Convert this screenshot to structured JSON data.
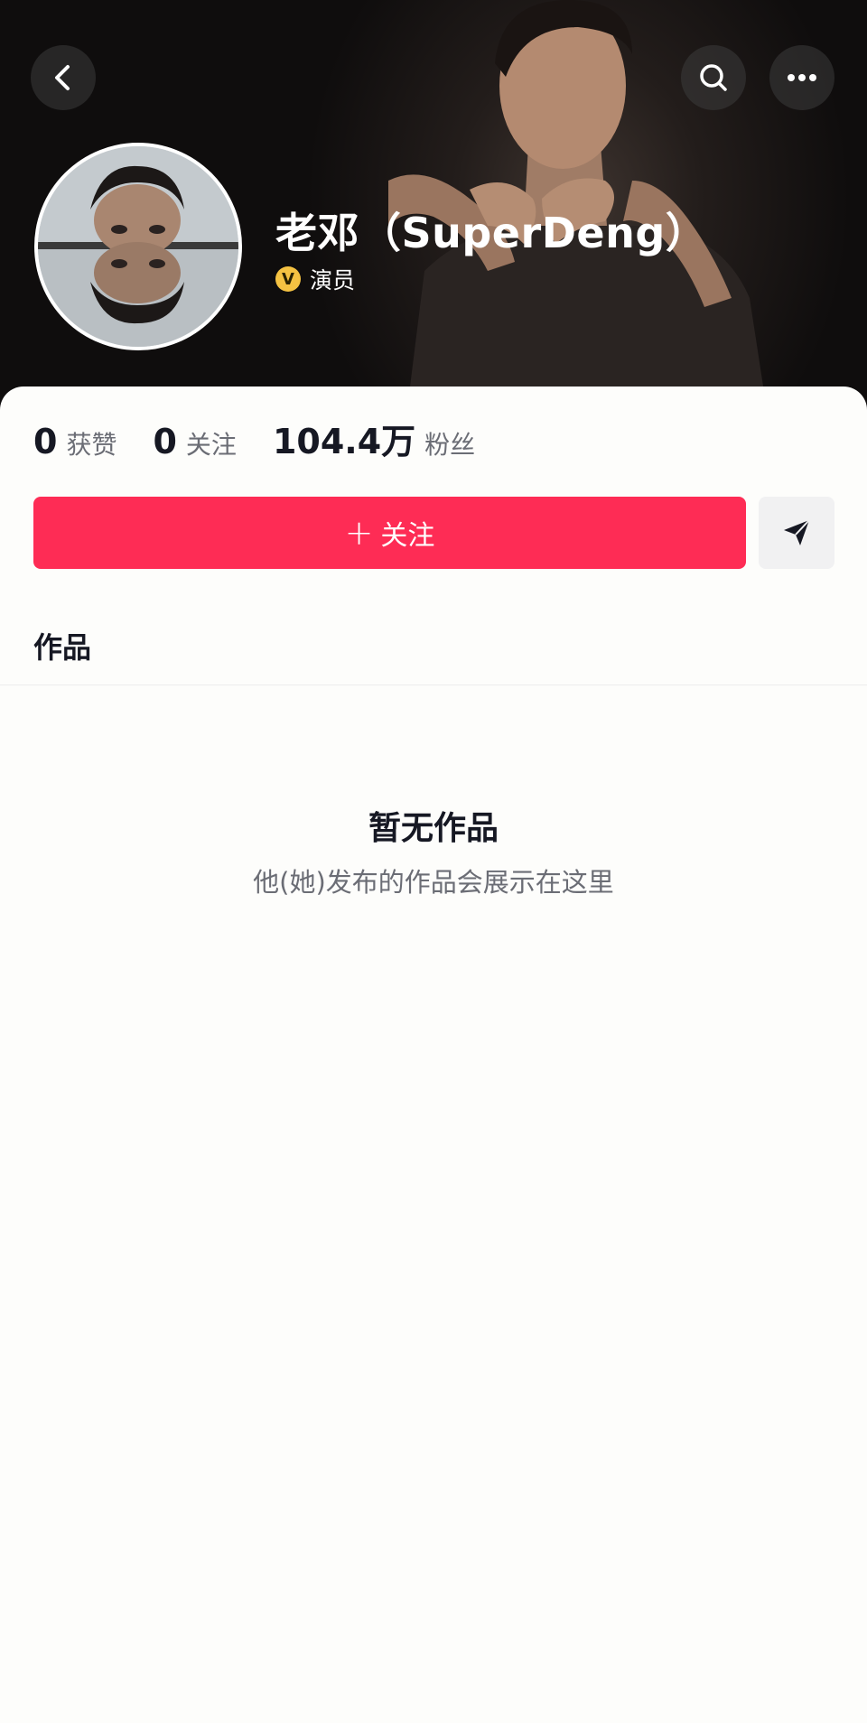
{
  "header": {
    "back_icon": "back-chevron-icon",
    "search_icon": "search-icon",
    "more_icon": "more-dots-icon"
  },
  "profile": {
    "name": "老邓（SuperDeng）",
    "verification_icon": "v-badge-icon",
    "verification_label": "演员",
    "verification_color": "#f5c242"
  },
  "stats": [
    {
      "value": "0",
      "label": "获赞"
    },
    {
      "value": "0",
      "label": "关注"
    },
    {
      "value": "104.4万",
      "label": "粉丝"
    }
  ],
  "actions": {
    "follow_plus": "+",
    "follow_label": "关注",
    "follow_color": "#fe2c55",
    "share_icon": "send-arrow-icon"
  },
  "tabs": {
    "works_label": "作品"
  },
  "empty_state": {
    "title": "暂无作品",
    "description": "他(她)发布的作品会展示在这里"
  }
}
